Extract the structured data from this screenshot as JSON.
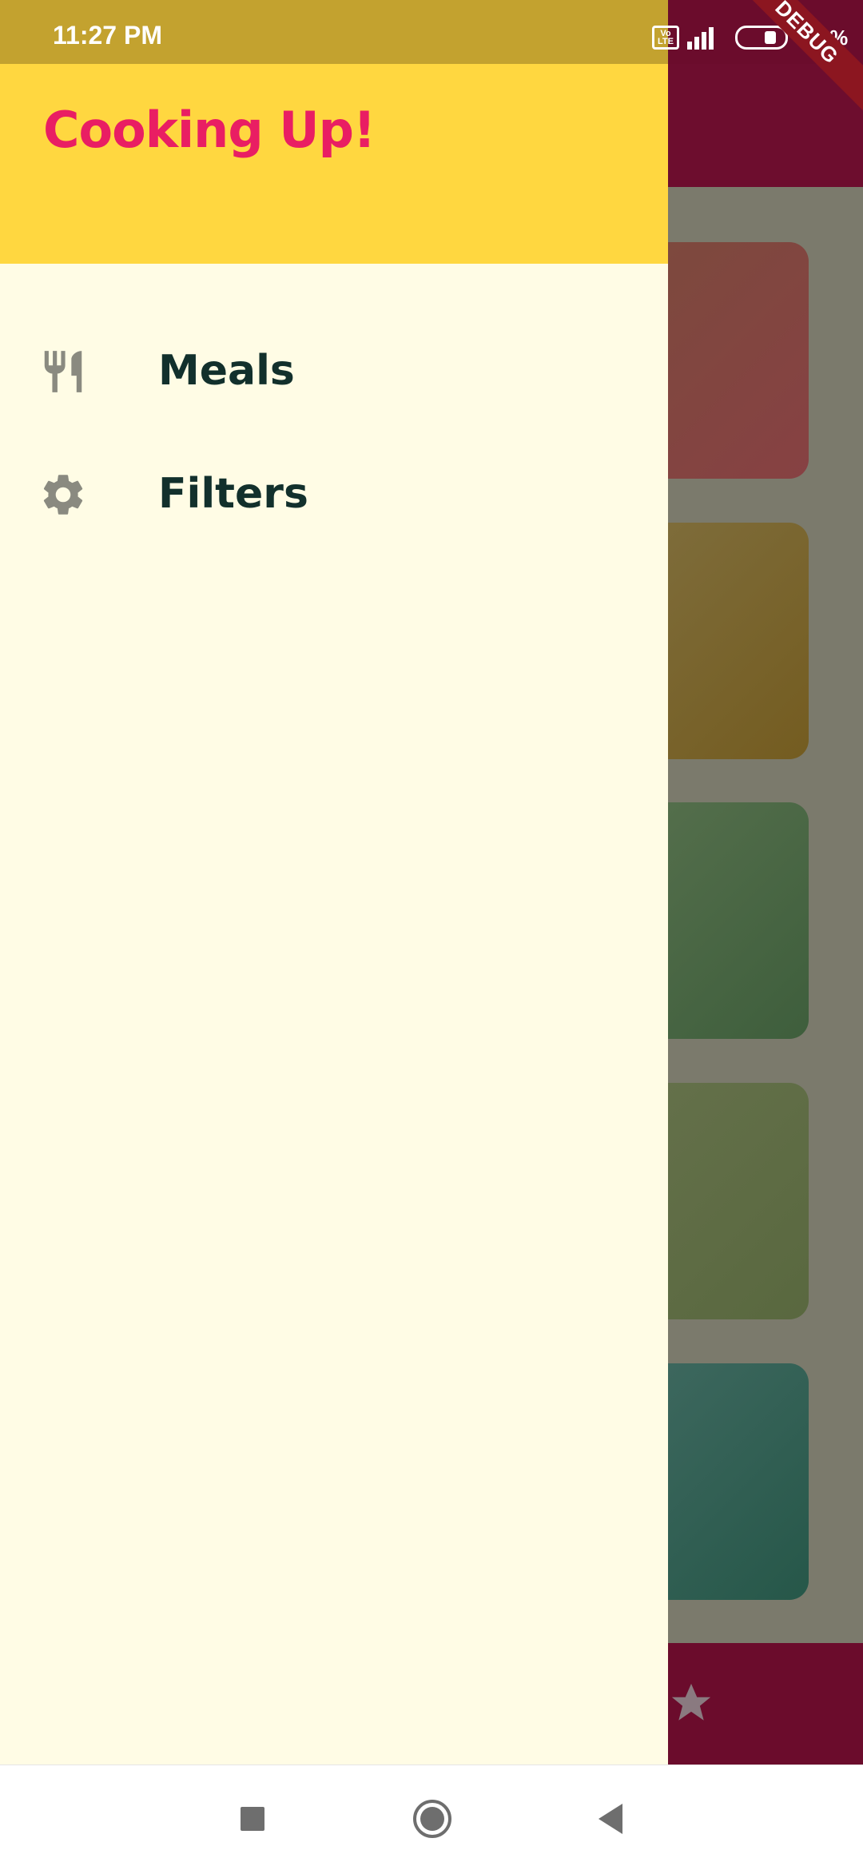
{
  "status_bar": {
    "time": "11:27 PM",
    "network_badge": "Vo LTE",
    "battery_label": "69 %",
    "debug_banner": "DEBUG"
  },
  "drawer": {
    "title": "Cooking Up!",
    "items": [
      {
        "label": "Meals",
        "icon": "restaurant-icon"
      },
      {
        "label": "Filters",
        "icon": "settings-icon"
      }
    ]
  },
  "colors": {
    "header": "#ffd740",
    "title": "#e91e63",
    "drawer_bg": "#fffce5",
    "label": "#12302c",
    "app_bar": "#6d0d2e"
  },
  "nav_bar": {
    "buttons": [
      "recents-icon",
      "home-icon",
      "back-icon"
    ]
  }
}
